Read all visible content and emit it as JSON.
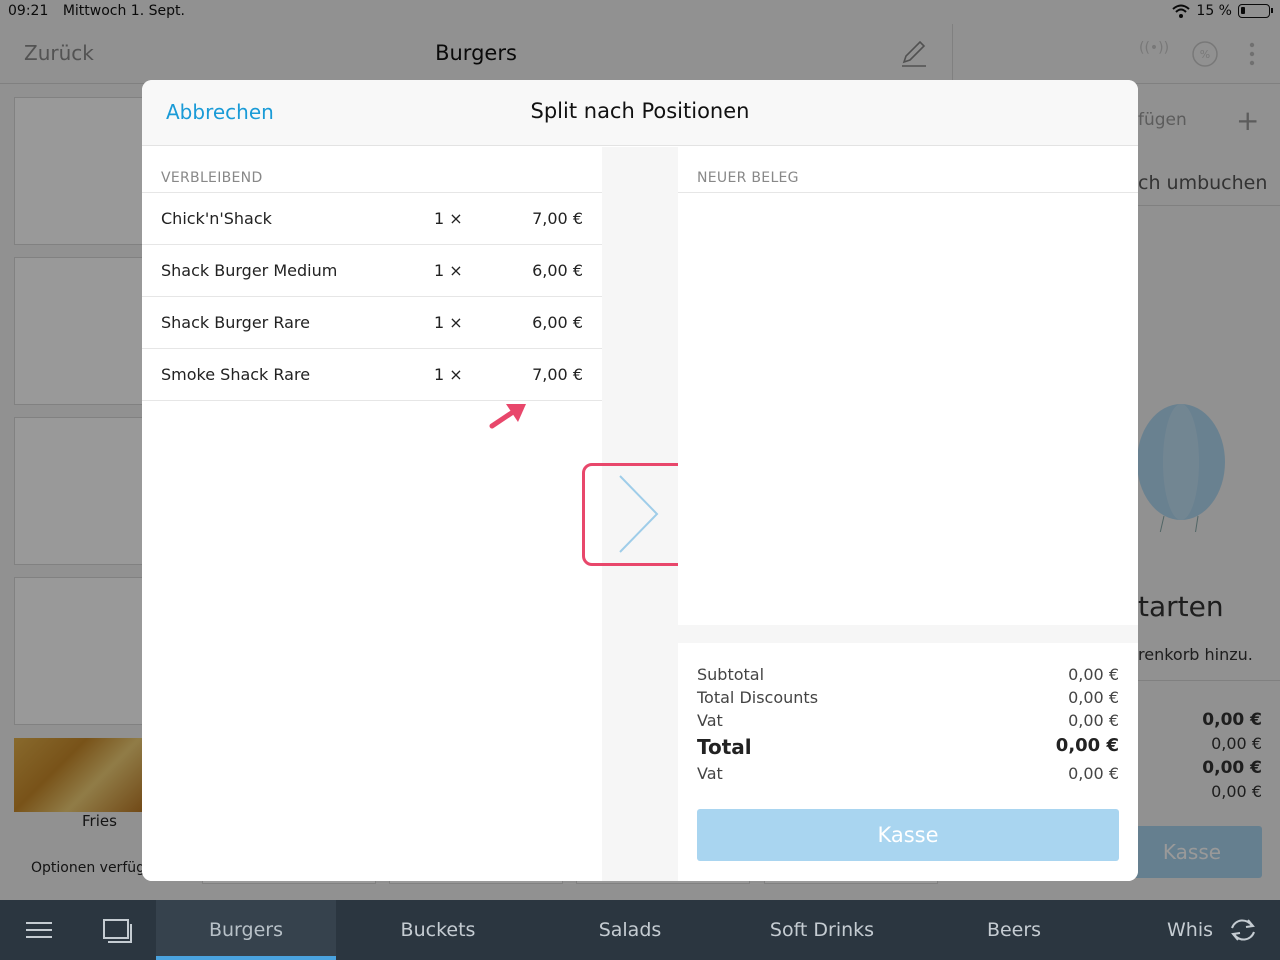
{
  "statusbar": {
    "time": "09:21",
    "date": "Mittwoch 1. Sept.",
    "battery": "15 %"
  },
  "nav": {
    "back_label": "Zurück",
    "title": "Burgers"
  },
  "sidepanel": {
    "add_label": "fügen",
    "rebook_label": "ch umbuchen",
    "empty_title": "tarten",
    "empty_hint": "renkorb hinzu.",
    "totals": [
      "0,00 €",
      "0,00 €",
      "0,00 €",
      "0,00 €"
    ],
    "kasse_label": "Kasse"
  },
  "products": {
    "fries_label": "Fries",
    "fries_options": "Optionen verfüg"
  },
  "modal": {
    "cancel_label": "Abbrechen",
    "title": "Split nach Positionen",
    "remaining_label": "VERBLEIBEND",
    "new_receipt_label": "NEUER BELEG",
    "items": [
      {
        "name": "Chick'n'Shack",
        "qty": "1 ×",
        "price": "7,00 €"
      },
      {
        "name": "Shack Burger Medium",
        "qty": "1 ×",
        "price": "6,00 €"
      },
      {
        "name": "Shack Burger Rare",
        "qty": "1 ×",
        "price": "6,00 €"
      },
      {
        "name": "Smoke Shack Rare",
        "qty": "1 ×",
        "price": "7,00 €"
      }
    ],
    "totals": {
      "subtotal_label": "Subtotal",
      "subtotal": "0,00 €",
      "discounts_label": "Total Discounts",
      "discounts": "0,00 €",
      "vat_label": "Vat",
      "vat": "0,00 €",
      "total_label": "Total",
      "total": "0,00 €",
      "vat2_label": "Vat",
      "vat2": "0,00 €"
    },
    "kasse_label": "Kasse"
  },
  "tabs": [
    {
      "label": "Burgers",
      "active": true
    },
    {
      "label": "Buckets"
    },
    {
      "label": "Salads"
    },
    {
      "label": "Soft Drinks"
    },
    {
      "label": "Beers"
    },
    {
      "label": "Whis"
    }
  ],
  "colors": {
    "accent": "#1a9bd7",
    "highlight": "#e8476b",
    "tabbar": "#2b3640",
    "kasse": "#a9d5f0"
  },
  "icons": [
    "menu-icon",
    "screen-icon",
    "refresh-icon",
    "edit-icon",
    "wifi-icon",
    "battery-icon",
    "chevron-right-icon",
    "percent-icon",
    "signal-icon",
    "more-icon",
    "plus-icon"
  ]
}
